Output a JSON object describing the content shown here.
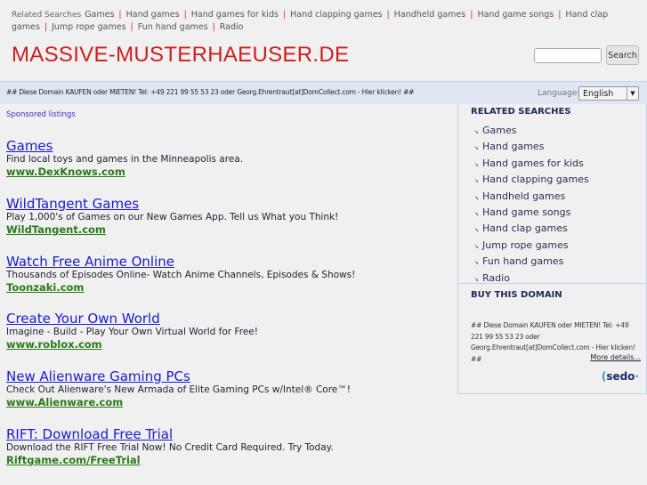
{
  "top": {
    "label": "Related Searches",
    "links": [
      "Games",
      "Hand games",
      "Hand games for kids",
      "Hand clapping games",
      "Handheld games",
      "Hand game songs",
      "Hand clap games",
      "Jump rope games",
      "Fun hand games",
      "Radio"
    ]
  },
  "site_title": "MASSIVE-MUSTERHAEUSER.DE",
  "search": {
    "value": "",
    "button": "Search"
  },
  "bar": {
    "message": "## Diese Domain KAUFEN oder MIETEN! Tel: +49 221 99 55 53 23 oder Georg.Ehrentraut[at]DomCollect.com - Hier klicken! ##",
    "language_label": "Language:",
    "language": "English"
  },
  "sponsored": "Sponsored listings",
  "ads": [
    {
      "title": "Games",
      "desc": "Find local toys and games in the Minneapolis area.",
      "url": "www.DexKnows.com"
    },
    {
      "title": "WildTangent Games",
      "desc": "Play 1,000's of Games on our New Games App. Tell us What you Think!",
      "url": "WildTangent.com"
    },
    {
      "title": "Watch Free Anime Online",
      "desc": "Thousands of Episodes Online- Watch Anime Channels, Episodes & Shows!",
      "url": "Toonzaki.com"
    },
    {
      "title": "Create Your Own World",
      "desc": "Imagine - Build - Play Your Own Virtual World for Free!",
      "url": "www.roblox.com"
    },
    {
      "title": "New Alienware Gaming PCs",
      "desc": "Check Out Alienware's New Armada of Elite Gaming PCs w/Intel® Core™!",
      "url": "www.Alienware.com"
    },
    {
      "title": "RIFT: Download Free Trial",
      "desc": "Download the RIFT Free Trial Now! No Credit Card Required. Try Today.",
      "url": "Riftgame.com/FreeTrial"
    }
  ],
  "side": {
    "related_title": "RELATED SEARCHES",
    "related": [
      "Games",
      "Hand games",
      "Hand games for kids",
      "Hand clapping games",
      "Handheld games",
      "Hand game songs",
      "Hand clap games",
      "Jump rope games",
      "Fun hand games",
      "Radio"
    ],
    "buy_title": "BUY THIS DOMAIN",
    "buy_text": "## Diese Domain KAUFEN oder MIETEN! Tel: +49 221 99 55 53 23 oder Georg.Ehrentraut[at]DomCollect.com - Hier klicken! ##",
    "more": "More details...",
    "logo": "sedo"
  }
}
